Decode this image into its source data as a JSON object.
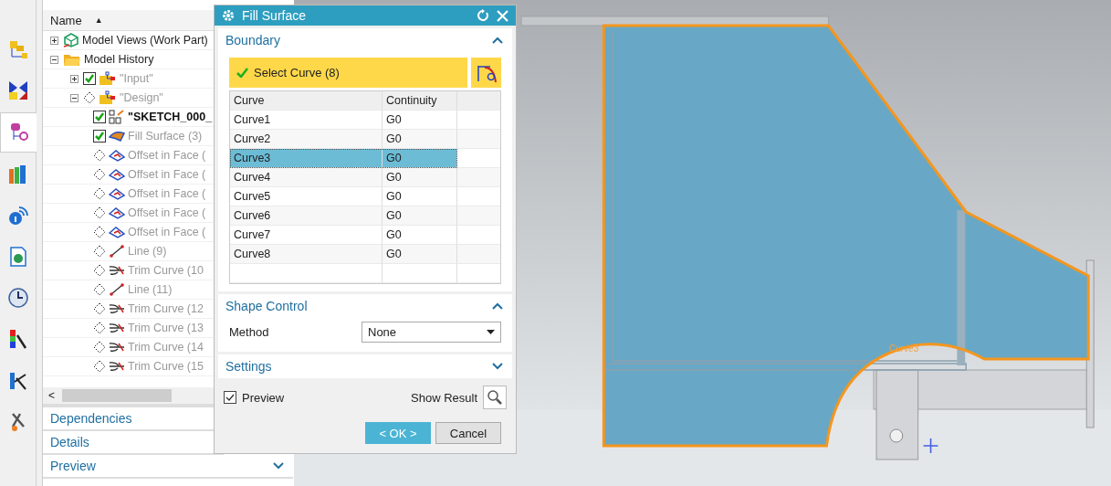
{
  "rail_tabs": [
    {
      "selected": false
    },
    {
      "selected": false
    },
    {
      "selected": true
    },
    {
      "selected": false
    },
    {
      "selected": false
    },
    {
      "selected": false
    },
    {
      "selected": false
    },
    {
      "selected": false
    },
    {
      "selected": false
    },
    {
      "selected": false
    }
  ],
  "navigator": {
    "column": "Name",
    "sort_indicator": "▲",
    "tree": [
      {
        "label": "Model Views (Work Part)",
        "kind": "views",
        "expanded": false
      },
      {
        "label": "Model History",
        "kind": "history",
        "expanded": true,
        "children": [
          {
            "label": "\"Input\"",
            "kind": "group",
            "checked": true,
            "expanded": false
          },
          {
            "label": "\"Design\"",
            "kind": "group",
            "checked": false,
            "expanded": true,
            "children": [
              {
                "label": "\"SKETCH_000_",
                "kind": "sketch",
                "checked": true,
                "current": true
              },
              {
                "label": "Fill Surface (3)",
                "kind": "surface",
                "checked": true,
                "current": false
              },
              {
                "label": "Offset in Face (",
                "kind": "offset",
                "checked": false,
                "current": false
              },
              {
                "label": "Offset in Face (",
                "kind": "offset",
                "checked": false,
                "current": false
              },
              {
                "label": "Offset in Face (",
                "kind": "offset",
                "checked": false,
                "current": false
              },
              {
                "label": "Offset in Face (",
                "kind": "offset",
                "checked": false,
                "current": false
              },
              {
                "label": "Offset in Face (",
                "kind": "offset",
                "checked": false,
                "current": false
              },
              {
                "label": "Line (9)",
                "kind": "line",
                "checked": false,
                "current": false
              },
              {
                "label": "Trim Curve (10",
                "kind": "trim",
                "checked": false,
                "current": false
              },
              {
                "label": "Line (11)",
                "kind": "line",
                "checked": false,
                "current": false
              },
              {
                "label": "Trim Curve (12",
                "kind": "trim",
                "checked": false,
                "current": false
              },
              {
                "label": "Trim Curve (13",
                "kind": "trim",
                "checked": false,
                "current": false
              },
              {
                "label": "Trim Curve (14",
                "kind": "trim",
                "checked": false,
                "current": false
              },
              {
                "label": "Trim Curve (15",
                "kind": "trim",
                "checked": false,
                "current": false
              }
            ]
          }
        ]
      }
    ],
    "scroll_left": "<",
    "panels": [
      {
        "label": "Dependencies"
      },
      {
        "label": "Details"
      },
      {
        "label": "Preview",
        "expanded": false
      }
    ]
  },
  "dialog": {
    "title": "Fill Surface",
    "sections": [
      {
        "kind": "boundary",
        "title": "Boundary",
        "expanded": true,
        "select_label": "Select Curve (8)",
        "columns": [
          "Curve",
          "Continuity"
        ],
        "rows": [
          {
            "curve": "Curve1",
            "continuity": "G0",
            "selected": false
          },
          {
            "curve": "Curve2",
            "continuity": "G0",
            "selected": false
          },
          {
            "curve": "Curve3",
            "continuity": "G0",
            "selected": true
          },
          {
            "curve": "Curve4",
            "continuity": "G0",
            "selected": false
          },
          {
            "curve": "Curve5",
            "continuity": "G0",
            "selected": false
          },
          {
            "curve": "Curve6",
            "continuity": "G0",
            "selected": false
          },
          {
            "curve": "Curve7",
            "continuity": "G0",
            "selected": false
          },
          {
            "curve": "Curve8",
            "continuity": "G0",
            "selected": false
          }
        ]
      },
      {
        "kind": "shape",
        "title": "Shape Control",
        "expanded": true,
        "method_label": "Method",
        "method_value": "None"
      },
      {
        "kind": "settings",
        "title": "Settings",
        "expanded": false
      }
    ],
    "preview": {
      "label": "Preview",
      "checked": true
    },
    "show_result": "Show Result",
    "ok": "< OK >",
    "cancel": "Cancel"
  },
  "viewport": {
    "curve_label": "Curve3"
  }
}
